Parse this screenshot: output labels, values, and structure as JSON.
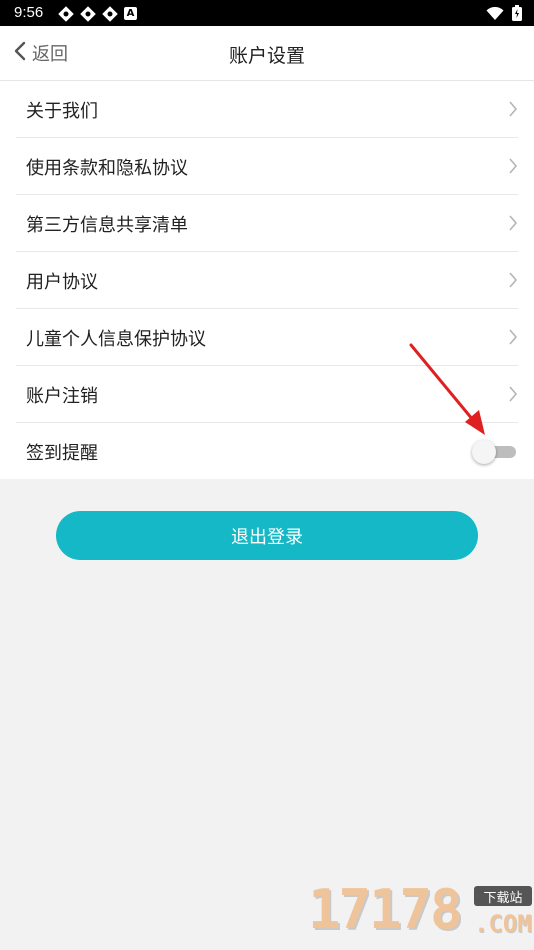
{
  "status_bar": {
    "time": "9:56",
    "app_letter": "A"
  },
  "header": {
    "back_label": "返回",
    "title": "账户设置"
  },
  "settings": [
    {
      "label": "关于我们"
    },
    {
      "label": "使用条款和隐私协议"
    },
    {
      "label": "第三方信息共享清单"
    },
    {
      "label": "用户协议"
    },
    {
      "label": "儿童个人信息保护协议"
    },
    {
      "label": "账户注销"
    }
  ],
  "checkin_reminder": {
    "label": "签到提醒",
    "enabled": false
  },
  "logout_label": "退出登录",
  "watermark": {
    "digits": "17178",
    "badge": "下载站",
    "suffix": ".COM"
  },
  "colors": {
    "accent": "#14b8c7",
    "annotation": "#e02020"
  }
}
